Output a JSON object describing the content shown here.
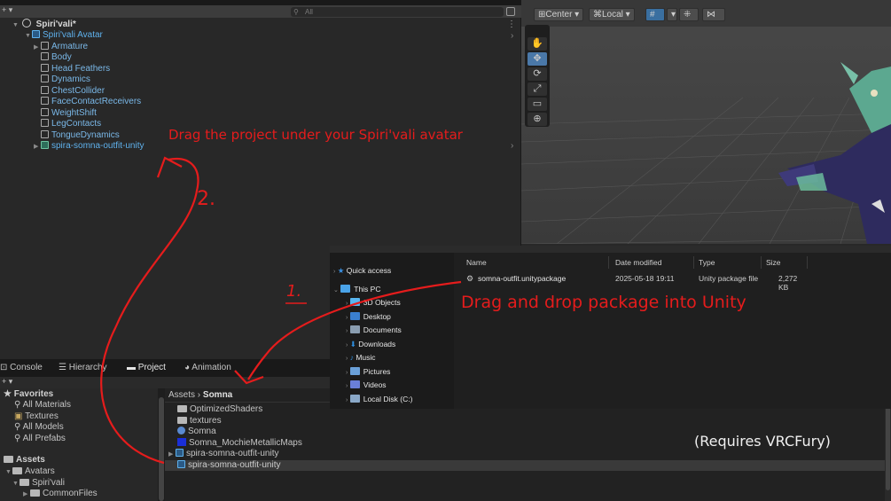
{
  "hierarchy": {
    "tab_label": "Hierarchy",
    "search_placeholder": "All",
    "scene_name": "Spiri'vali*",
    "items": [
      {
        "label": "Spiri'vali Avatar"
      },
      {
        "label": "Armature"
      },
      {
        "label": "Body"
      },
      {
        "label": "Head Feathers"
      },
      {
        "label": "Dynamics"
      },
      {
        "label": "ChestCollider"
      },
      {
        "label": "FaceContactReceivers"
      },
      {
        "label": "WeightShift"
      },
      {
        "label": "LegContacts"
      },
      {
        "label": "TongueDynamics"
      },
      {
        "label": "spira-somna-outfit-unity"
      }
    ]
  },
  "scene_toolbar": {
    "pivot": "Center",
    "space": "Local"
  },
  "explorer": {
    "columns": {
      "name": "Name",
      "date": "Date modified",
      "type": "Type",
      "size": "Size"
    },
    "sidebar": [
      {
        "label": "Quick access",
        "color": "#3a8fe0"
      },
      {
        "label": "This PC",
        "color": "#4aa3e8"
      },
      {
        "label": "3D Objects",
        "color": "#58b6f0"
      },
      {
        "label": "Desktop",
        "color": "#3a7fd0"
      },
      {
        "label": "Documents",
        "color": "#8a9db0"
      },
      {
        "label": "Downloads",
        "color": "#2f8fe0"
      },
      {
        "label": "Music",
        "color": "#2f8fe0"
      },
      {
        "label": "Pictures",
        "color": "#6aa0d8"
      },
      {
        "label": "Videos",
        "color": "#6a7fd8"
      },
      {
        "label": "Local Disk (C:)",
        "color": "#8aa8c8"
      }
    ],
    "file": {
      "name": "somna-outfit.unitypackage",
      "date": "2025-05-18 19:11",
      "type": "Unity package file",
      "size": "2,272 KB"
    }
  },
  "bottom": {
    "tabs": {
      "console": "Console",
      "hierarchy": "Hierarchy",
      "project": "Project",
      "animation": "Animation"
    },
    "favorites_title": "Favorites",
    "favorites": [
      "All Materials",
      "Textures",
      "All Models",
      "All Prefabs"
    ],
    "assets_title": "Assets",
    "tree": [
      "Avatars",
      "Spiri'vali",
      "CommonFiles"
    ],
    "breadcrumb_root": "Assets",
    "breadcrumb_current": "Somna",
    "assets": [
      {
        "label": "OptimizedShaders",
        "kind": "folder"
      },
      {
        "label": "textures",
        "kind": "folder"
      },
      {
        "label": "Somna",
        "kind": "scene"
      },
      {
        "label": "Somna_MochieMetallicMaps",
        "kind": "texture"
      },
      {
        "label": "spira-somna-outfit-unity",
        "kind": "prefab"
      },
      {
        "label": "spira-somna-outfit-unity",
        "kind": "package"
      }
    ]
  },
  "annotations": {
    "drag_hint": "Drag the project under your Spiri'vali avatar",
    "drop_hint": "Drag and drop package into Unity",
    "step1": "1.",
    "step2": "2.",
    "requires": "(Requires VRCFury)"
  },
  "colors": {
    "annotation": "#e51c1c",
    "selection_blue": "#2c5d87"
  }
}
